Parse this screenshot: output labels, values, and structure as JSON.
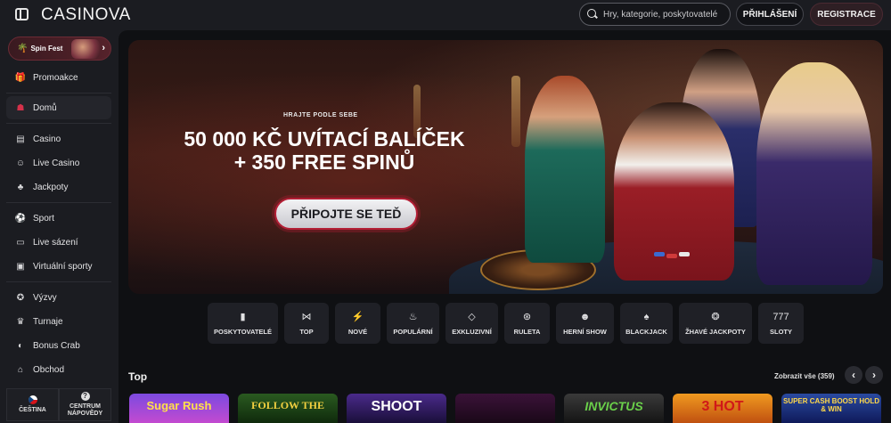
{
  "header": {
    "logo": "CASINOVA",
    "search_placeholder": "Hry, kategorie, poskytovatelé",
    "login_label": "PŘIHLÁŠENÍ",
    "register_label": "REGISTRACE"
  },
  "sidebar": {
    "spin_fest": "Spin Fest",
    "items": [
      {
        "label": "Promoakce",
        "icon": "gift-icon"
      },
      {
        "label": "Domů",
        "icon": "home-icon"
      },
      {
        "label": "Casino",
        "icon": "slot-machine-icon"
      },
      {
        "label": "Live Casino",
        "icon": "live-dealer-icon"
      },
      {
        "label": "Jackpoty",
        "icon": "clover-icon"
      },
      {
        "label": "Sport",
        "icon": "soccer-ball-icon"
      },
      {
        "label": "Live sázení",
        "icon": "live-tv-icon"
      },
      {
        "label": "Virtuální sporty",
        "icon": "virtual-sports-icon"
      },
      {
        "label": "Výzvy",
        "icon": "medal-icon"
      },
      {
        "label": "Turnaje",
        "icon": "trophy-icon"
      },
      {
        "label": "Bonus Crab",
        "icon": "crab-icon"
      },
      {
        "label": "Obchod",
        "icon": "shop-icon"
      }
    ],
    "active": "Domů",
    "language": "ČEŠTINA",
    "help": "CENTRUM NÁPOVĚDY"
  },
  "banner": {
    "subtitle": "HRAJTE PODLE SEBE",
    "title_line1": "50 000 KČ UVÍTACÍ BALÍČEK",
    "title_line2": "+ 350 FREE SPINŮ",
    "cta": "PŘIPOJTE SE TEĎ"
  },
  "categories": [
    {
      "label": "POSKYTOVATELÉ",
      "icon": "provider-card-icon"
    },
    {
      "label": "TOP",
      "icon": "bow-icon"
    },
    {
      "label": "NOVÉ",
      "icon": "lightning-icon"
    },
    {
      "label": "POPULÁRNÍ",
      "icon": "flame-icon"
    },
    {
      "label": "EXKLUZIVNÍ",
      "icon": "diamond-icon"
    },
    {
      "label": "RULETA",
      "icon": "roulette-icon"
    },
    {
      "label": "HERNÍ SHOW",
      "icon": "mask-icon"
    },
    {
      "label": "BLACKJACK",
      "icon": "cards-icon"
    },
    {
      "label": "ŽHAVÉ JACKPOTY",
      "icon": "hot-jackpot-icon"
    },
    {
      "label": "SLOTY",
      "icon": "777-icon"
    }
  ],
  "top_section": {
    "title": "Top",
    "view_all": "Zobrazit vše (359)"
  },
  "games": [
    {
      "title": "Sugar Rush",
      "color": "#6a3fd1"
    },
    {
      "title": "FOLLOW THE",
      "color": "#1e4a1a"
    },
    {
      "title": "SHOOT",
      "color": "#3a1a6a"
    },
    {
      "title": "",
      "color": "#2a0f2a"
    },
    {
      "title": "INVICTUS",
      "color": "#2a2a2a"
    },
    {
      "title": "3 HOT",
      "color": "#e07a10"
    },
    {
      "title": "SUPER CASH BOOST HOLD & WIN",
      "color": "#1a3a8a"
    }
  ],
  "colors": {
    "accent": "#d4314a",
    "background": "#1b1c21",
    "main_background": "#0f1013"
  }
}
